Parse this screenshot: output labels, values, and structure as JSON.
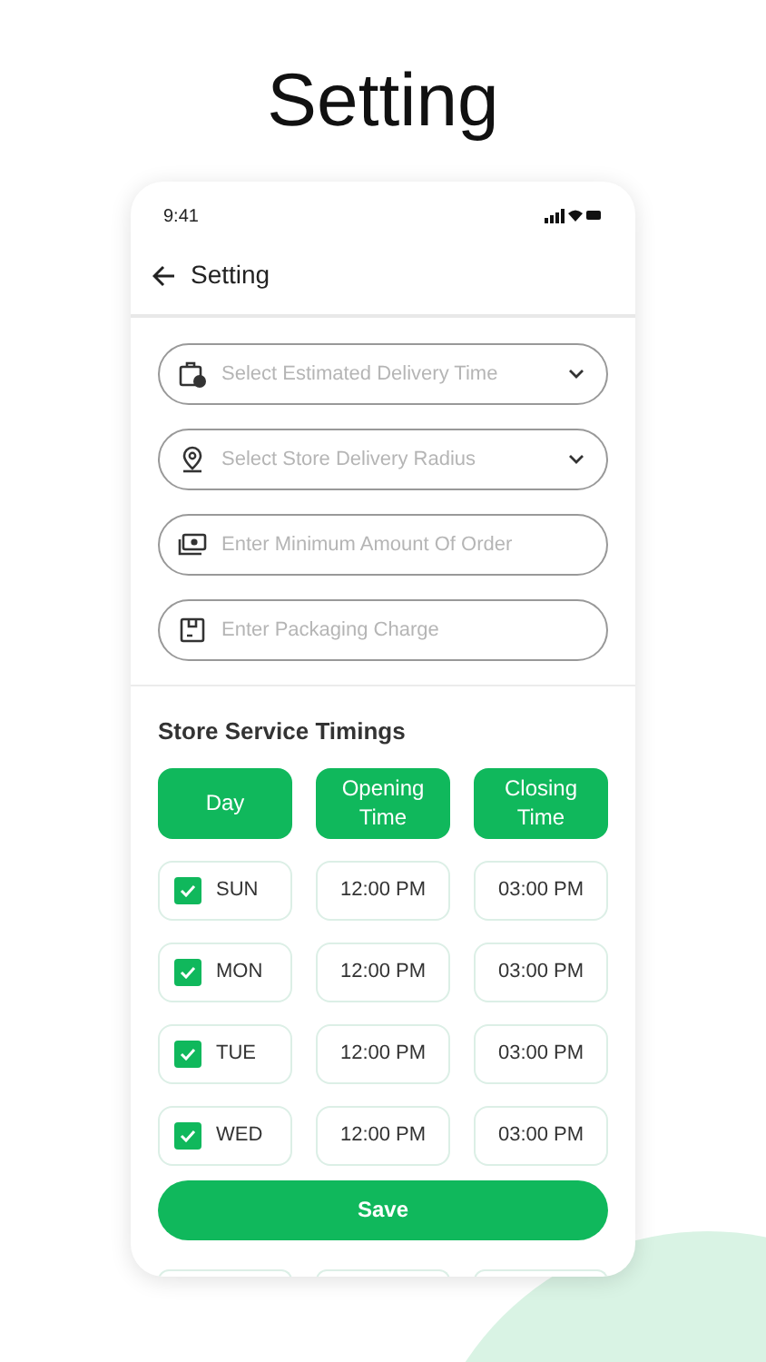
{
  "page_title": "Setting",
  "status_bar": {
    "time": "9:41"
  },
  "header": {
    "title": "Setting"
  },
  "fields": [
    {
      "kind": "select",
      "placeholder": "Select Estimated Delivery Time"
    },
    {
      "kind": "select",
      "placeholder": "Select Store Delivery Radius"
    },
    {
      "kind": "input",
      "placeholder": "Enter Minimum Amount Of Order"
    },
    {
      "kind": "input",
      "placeholder": "Enter Packaging Charge"
    }
  ],
  "section_title": "Store Service Timings",
  "columns": [
    "Day",
    "Opening Time",
    "Closing Time"
  ],
  "rows": [
    {
      "day": "SUN",
      "checked": true,
      "opening": "12:00 PM",
      "closing": "03:00 PM"
    },
    {
      "day": "MON",
      "checked": true,
      "opening": "12:00 PM",
      "closing": "03:00 PM"
    },
    {
      "day": "TUE",
      "checked": true,
      "opening": "12:00 PM",
      "closing": "03:00 PM"
    },
    {
      "day": "WED",
      "checked": true,
      "opening": "12:00 PM",
      "closing": "03:00 PM"
    }
  ],
  "save_button": "Save"
}
